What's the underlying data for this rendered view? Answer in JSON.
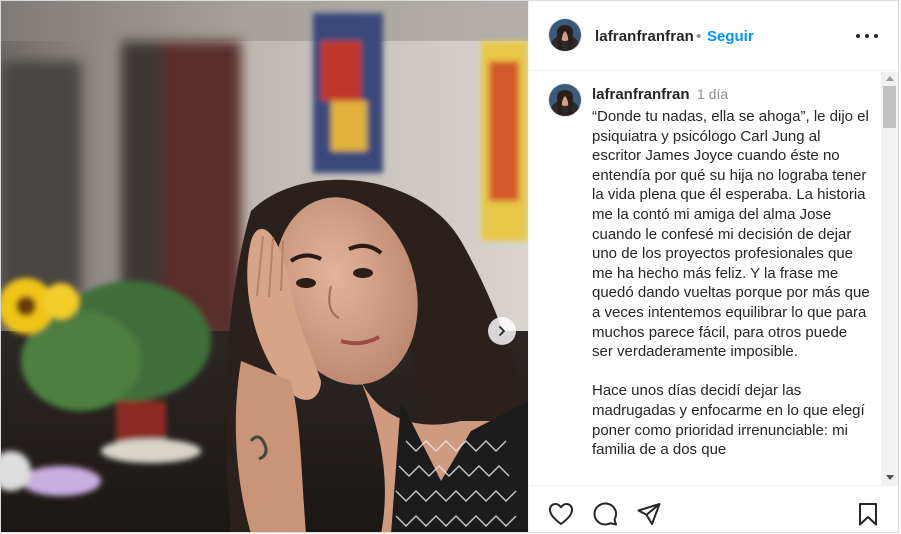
{
  "post": {
    "author": "lafranfranfran",
    "follow_label": "Seguir",
    "separator": "•",
    "more_options": "more-icon"
  },
  "comment": {
    "author": "lafranfranfran",
    "time": "1 día",
    "paragraphs": [
      "“Donde tu nadas, ella se ahoga”, le dijo el psiquiatra y psicólogo Carl Jung al escritor James Joyce cuando éste no entendía por qué su hija no lograba tener la vida plena que él esperaba. La historia me la contó mi amiga del alma Jose cuando le confesé mi decisión de dejar uno de los proyectos profesionales que me ha hecho más feliz. Y la frase me quedó dando vueltas porque por más que a veces intentemos equilibrar lo que para muchos parece fácil, para otros puede ser verdaderamente imposible.",
      "Hace unos días decidí dejar las madrugadas y enfocarme en lo que elegí poner como prioridad irrenunciable: mi familia de a dos que"
    ]
  },
  "actions": {
    "icons": [
      "heart-icon",
      "comment-icon",
      "share-icon",
      "bookmark-icon"
    ]
  },
  "colors": {
    "link_blue": "#0095f6",
    "text": "#262626",
    "muted": "#8e8e8e"
  }
}
